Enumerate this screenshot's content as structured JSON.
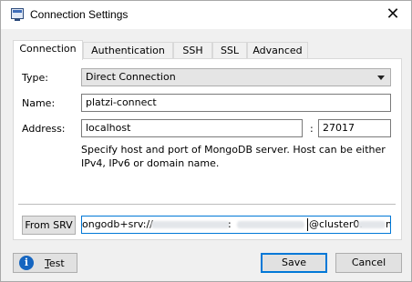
{
  "window": {
    "title": "Connection Settings",
    "close_glyph": "✕"
  },
  "tabs": [
    {
      "label": "Connection",
      "active": true
    },
    {
      "label": "Authentication",
      "active": false
    },
    {
      "label": "SSH",
      "active": false
    },
    {
      "label": "SSL",
      "active": false
    },
    {
      "label": "Advanced",
      "active": false
    }
  ],
  "connection": {
    "type_label": "Type:",
    "type_value": "Direct Connection",
    "name_label": "Name:",
    "name_value": "platzi-connect",
    "address_label": "Address:",
    "host_value": "localhost",
    "port_separator": ":",
    "port_value": "27017",
    "hint": "Specify host and port of MongoDB server. Host can be either IPv4, IPv6 or domain name.",
    "from_srv_label": "From SRV",
    "srv_prefix": "ongodb+srv://",
    "srv_mid": ":",
    "srv_suffix": "@cluster0.",
    "srv_tail": "m"
  },
  "footer": {
    "test_icon": "info-icon",
    "test_first": "T",
    "test_rest": "est",
    "save_label": "Save",
    "cancel_label": "Cancel"
  },
  "colors": {
    "accent": "#0078d7",
    "info": "#1565c0"
  }
}
